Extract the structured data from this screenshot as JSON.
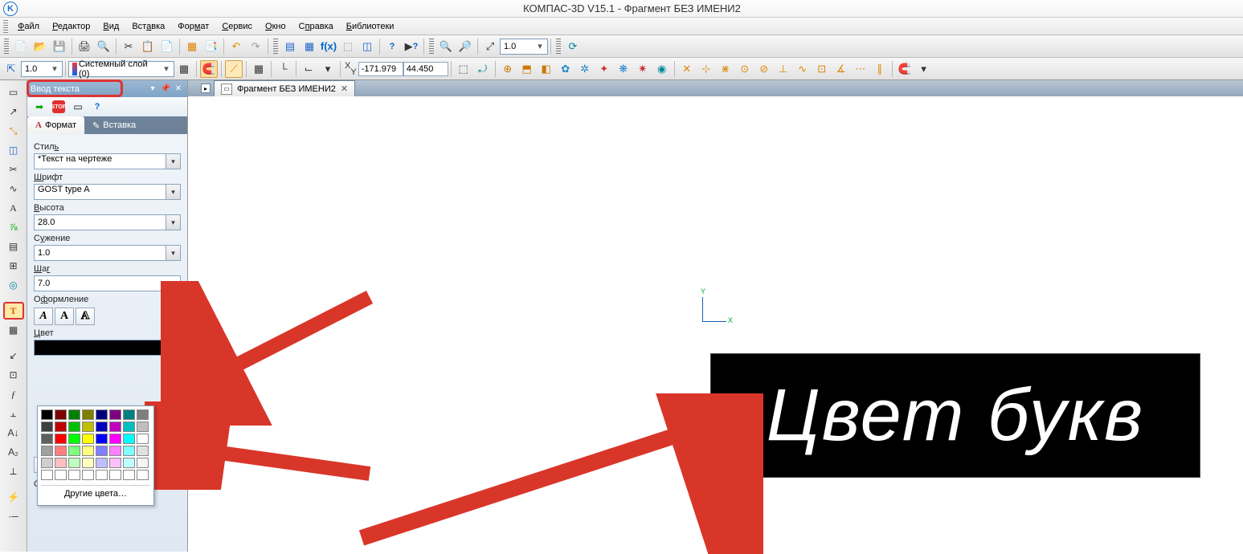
{
  "title": "КОМПАС-3D V15.1 - Фрагмент БЕЗ ИМЕНИ2",
  "menus": {
    "file": "Файл",
    "editor": "Редактор",
    "view": "Вид",
    "insert": "Вставка",
    "format": "Формат",
    "service": "Сервис",
    "window": "Окно",
    "help": "Справка",
    "libs": "Библиотеки"
  },
  "tb1": {
    "scale": "1.0"
  },
  "tb2": {
    "step": "1.0",
    "layer": "Системный слой (0)",
    "x": "-171.979",
    "y": "44.450",
    "xlabel": "X",
    "ylabel": "Y"
  },
  "doc_tab": "Фрагмент БЕЗ ИМЕНИ2",
  "panel": {
    "title": "Ввод текста",
    "tab_format": "Формат",
    "tab_insert": "Вставка",
    "style_lbl": "Стиль",
    "style_val": "*Текст на чертеже",
    "font_lbl": "Шрифт",
    "font_val": "GOST type A",
    "height_lbl": "Высота",
    "height_val": "28.0",
    "narrow_lbl": "Сужение",
    "narrow_val": "1.0",
    "step_lbl": "Шаг",
    "step_val": "7.0",
    "decor_lbl": "Оформление",
    "color_lbl": "Цвет",
    "more_colors": "Другие цвета…",
    "list_lbl": "Список"
  },
  "canvas_text": "Цвет букв",
  "axis": {
    "x": "X",
    "y": "Y"
  },
  "palette_colors": [
    "#000000",
    "#7f0000",
    "#007f00",
    "#7f7f00",
    "#00007f",
    "#7f007f",
    "#007f7f",
    "#7f7f7f",
    "#3f3f3f",
    "#bf0000",
    "#00bf00",
    "#bfbf00",
    "#0000bf",
    "#bf00bf",
    "#00bfbf",
    "#bfbfbf",
    "#5f5f5f",
    "#ff0000",
    "#00ff00",
    "#ffff00",
    "#0000ff",
    "#ff00ff",
    "#00ffff",
    "#ffffff",
    "#9f9f9f",
    "#ff7f7f",
    "#7fff7f",
    "#ffff7f",
    "#7f7fff",
    "#ff7fff",
    "#7fffff",
    "#e0e0e0",
    "#cfcfcf",
    "#ffbfbf",
    "#bfffbf",
    "#ffffbf",
    "#bfbfff",
    "#ffbfff",
    "#bfffff",
    "#f4f4f4",
    "#ffffff",
    "#ffffff",
    "#ffffff",
    "#ffffff",
    "#ffffff",
    "#ffffff",
    "#ffffff",
    "#ffffff"
  ]
}
